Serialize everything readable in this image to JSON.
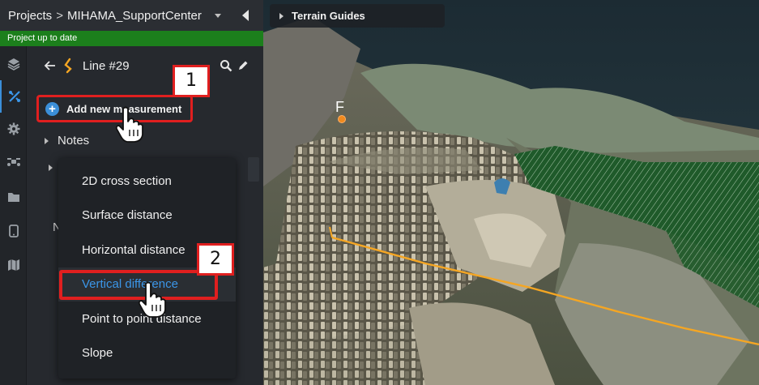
{
  "topbar": {
    "projects_label": "Projects",
    "separator": ">",
    "project_name": "MIHAMA_SupportCenter"
  },
  "status": {
    "text": "Project up to date",
    "color": "#1c7f1c"
  },
  "rail": {
    "icons": [
      "layers-icon",
      "measure-tools-icon",
      "settings-gear-icon",
      "drone-icon",
      "folder-icon",
      "mobile-device-icon",
      "map-icon"
    ],
    "active_index": 1
  },
  "line": {
    "title": "Line #29"
  },
  "actions": {
    "add_measurement": "Add new measurement"
  },
  "tree": {
    "notes_label": "Notes",
    "partial_letter": "N"
  },
  "menu": {
    "items": [
      "2D cross section",
      "Surface distance",
      "Horizontal distance",
      "Vertical difference",
      "Point to point distance",
      "Slope"
    ],
    "highlighted_index": 3
  },
  "viewport": {
    "terrain_guides_label": "Terrain Guides",
    "point_label": "F"
  },
  "callouts": {
    "one": "1",
    "two": "2"
  },
  "colors": {
    "accent": "#3b96e8",
    "callout_border": "#e01f1f",
    "measurement_line": "#f5a623"
  }
}
